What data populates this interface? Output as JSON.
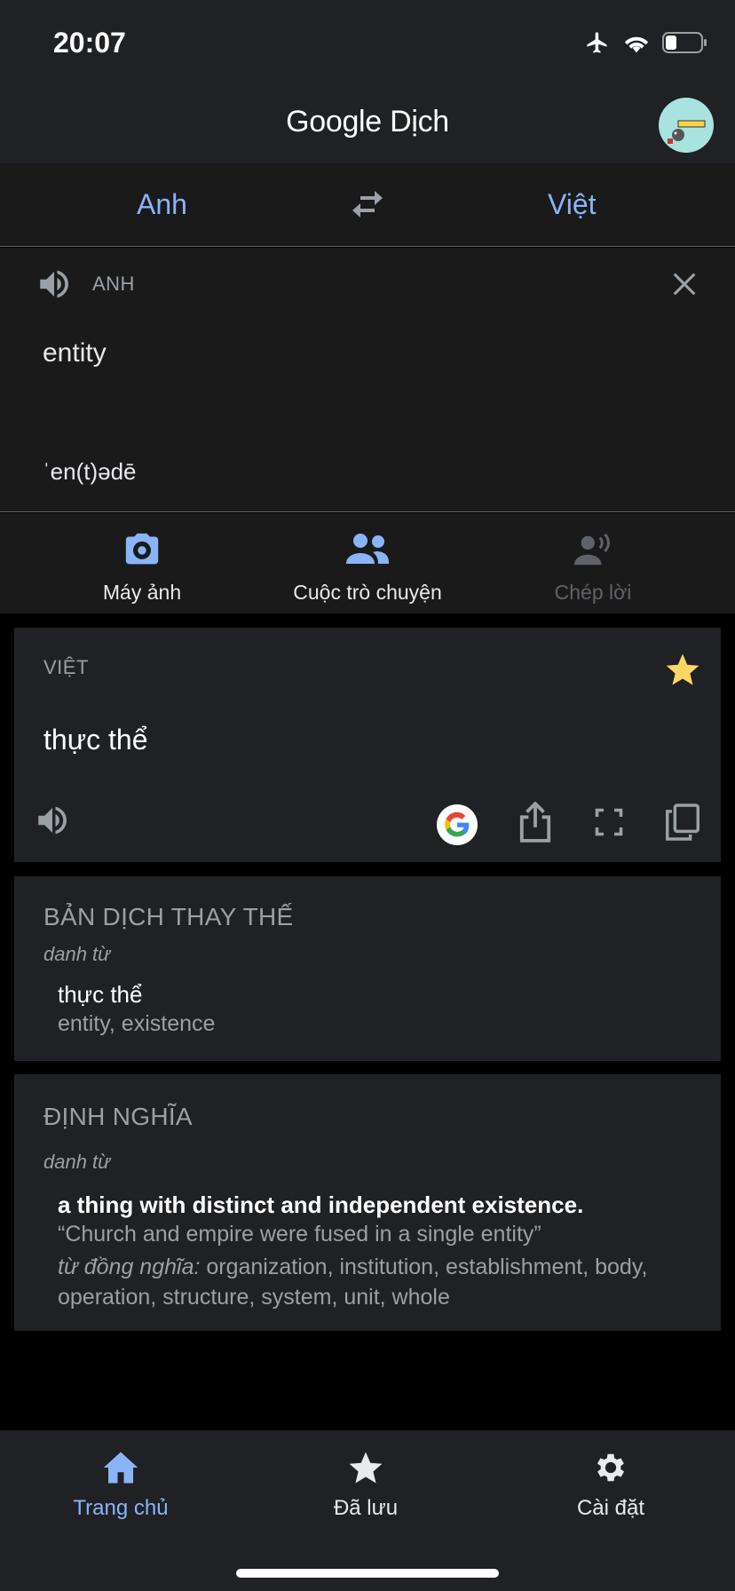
{
  "status_bar": {
    "time": "20:07"
  },
  "app": {
    "title_google": "Google",
    "title_product": "Dịch"
  },
  "languages": {
    "source": "Anh",
    "target": "Việt"
  },
  "input": {
    "language_label": "ANH",
    "text": "entity",
    "phonetic": "ˈen(t)ədē"
  },
  "tools": [
    {
      "label": "Máy ảnh",
      "icon": "camera-icon"
    },
    {
      "label": "Cuộc trò chuyện",
      "icon": "conversation-icon"
    },
    {
      "label": "Chép lời",
      "icon": "transcribe-icon"
    }
  ],
  "result": {
    "language_label": "VIỆT",
    "text": "thực thể"
  },
  "alternatives": {
    "title": "BẢN DỊCH THAY THẾ",
    "part_of_speech": "danh từ",
    "word": "thực thể",
    "gloss": "entity, existence"
  },
  "definitions": {
    "title": "ĐỊNH NGHĨA",
    "part_of_speech": "danh từ",
    "definition": "a thing with distinct and independent existence.",
    "example": "“Church and empire were fused in a single entity”",
    "synonyms_label": "từ đồng nghĩa:",
    "synonyms": " organization, institution, establishment, body, operation, structure, system, unit, whole"
  },
  "nav": [
    {
      "label": "Trang chủ",
      "icon": "home-icon",
      "active": true
    },
    {
      "label": "Đã lưu",
      "icon": "star-icon"
    },
    {
      "label": "Cài đặt",
      "icon": "gear-icon"
    }
  ],
  "colors": {
    "accent": "#8ab4f8",
    "star": "#fdd663",
    "surface": "#202124",
    "background": "#000000"
  }
}
